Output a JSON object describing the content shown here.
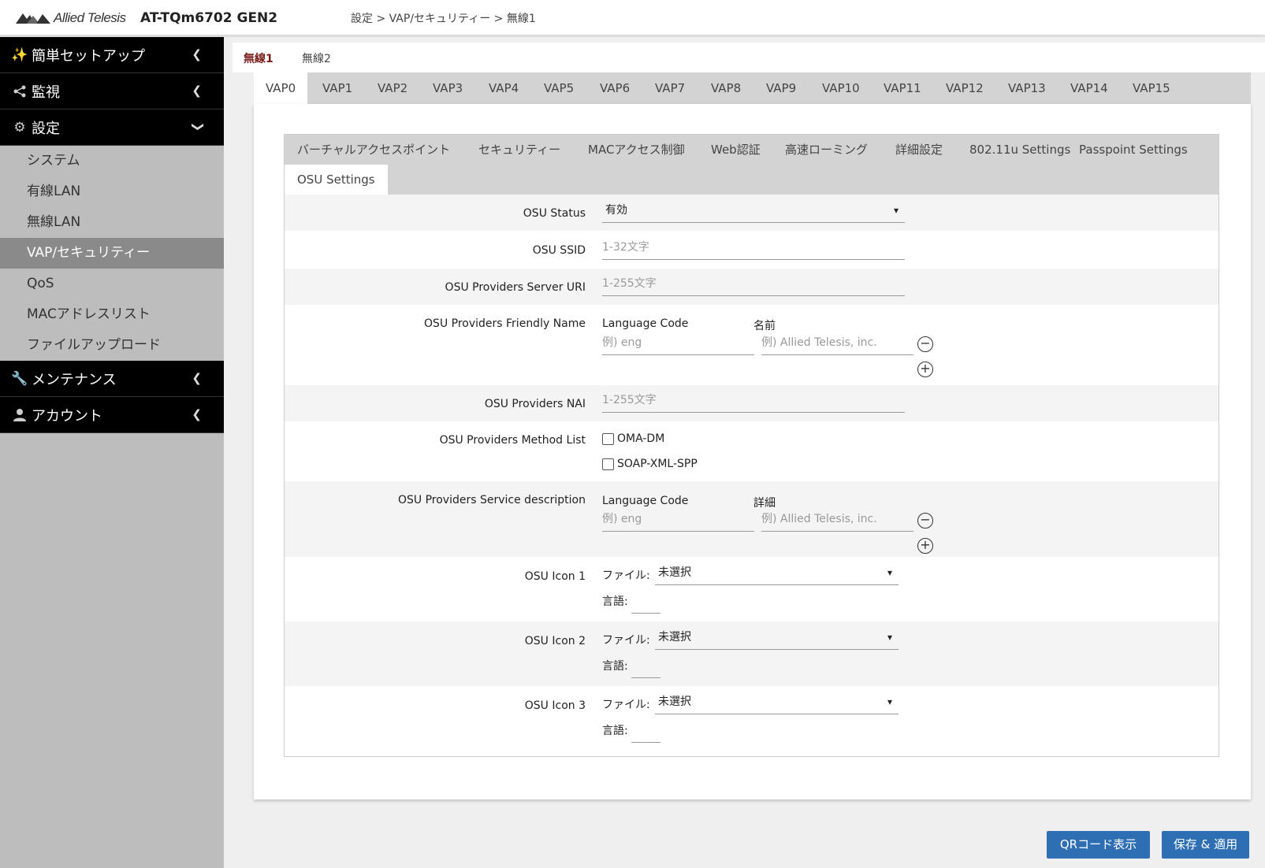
{
  "header": {
    "logo_text": "Allied Telesis",
    "model": "AT-TQm6702 GEN2",
    "breadcrumb": "設定 > VAP/セキュリティー > 無線1"
  },
  "sidebar": {
    "main_items": [
      {
        "label": "簡単セットアップ",
        "icon": "wand-icon"
      },
      {
        "label": "監視",
        "icon": "share-icon"
      },
      {
        "label": "設定",
        "icon": "gear-icon"
      },
      {
        "label": "メンテナンス",
        "icon": "wrench-icon"
      },
      {
        "label": "アカウント",
        "icon": "user-icon"
      }
    ],
    "sub_items": [
      "システム",
      "有線LAN",
      "無線LAN",
      "VAP/セキュリティー",
      "QoS",
      "MACアドレスリスト",
      "ファイルアップロード"
    ],
    "active_sub": "VAP/セキュリティー"
  },
  "radio_tabs": [
    "無線1",
    "無線2"
  ],
  "vap_tabs": [
    "VAP0",
    "VAP1",
    "VAP2",
    "VAP3",
    "VAP4",
    "VAP5",
    "VAP6",
    "VAP7",
    "VAP8",
    "VAP9",
    "VAP10",
    "VAP11",
    "VAP12",
    "VAP13",
    "VAP14",
    "VAP15"
  ],
  "sub_tabs": [
    "バーチャルアクセスポイント",
    "セキュリティー",
    "MACアクセス制御",
    "Web認証",
    "高速ローミング",
    "詳細設定",
    "802.11u Settings",
    "Passpoint Settings",
    "OSU Settings"
  ],
  "form": {
    "osu_status": {
      "label": "OSU Status",
      "value": "有効"
    },
    "osu_ssid": {
      "label": "OSU SSID",
      "placeholder": "1-32文字"
    },
    "osu_server_uri": {
      "label": "OSU Providers Server URI",
      "placeholder": "1-255文字"
    },
    "friendly_name": {
      "label": "OSU Providers Friendly Name",
      "lang_header": "Language Code",
      "name_header": "名前",
      "lang_placeholder": "例) eng",
      "name_placeholder": "例) Allied Telesis, inc."
    },
    "nai": {
      "label": "OSU Providers NAI",
      "placeholder": "1-255文字"
    },
    "method_list": {
      "label": "OSU Providers Method List",
      "options": [
        "OMA-DM",
        "SOAP-XML-SPP"
      ]
    },
    "service_desc": {
      "label": "OSU Providers Service description",
      "lang_header": "Language Code",
      "detail_header": "詳細",
      "lang_placeholder": "例) eng",
      "detail_placeholder": "例) Allied Telesis, inc."
    },
    "icons": [
      {
        "label": "OSU Icon 1",
        "file_label": "ファイル:",
        "file_value": "未選択",
        "lang_label": "言語:"
      },
      {
        "label": "OSU Icon 2",
        "file_label": "ファイル:",
        "file_value": "未選択",
        "lang_label": "言語:"
      },
      {
        "label": "OSU Icon 3",
        "file_label": "ファイル:",
        "file_value": "未選択",
        "lang_label": "言語:"
      }
    ]
  },
  "buttons": {
    "qr": "QRコード表示",
    "save": "保存 & 適用"
  },
  "colors": {
    "accent_blue": "#2e6fb4",
    "active_tab_text": "#7a1c1c",
    "sidebar_bg": "#bdbdbd"
  }
}
